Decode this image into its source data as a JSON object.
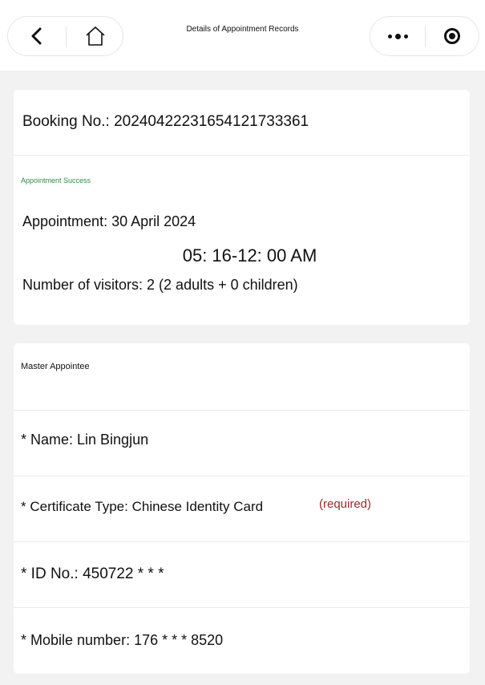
{
  "header": {
    "title": "Details of Appointment Records",
    "back_icon": "chevron-left-icon",
    "home_icon": "home-icon",
    "more_icon": "more-dots-icon",
    "close_icon": "target-circle-icon"
  },
  "booking": {
    "number_text": "Booking No.: 20240422231654121733361"
  },
  "appointment": {
    "status": "Appointment Success",
    "date_text": "Appointment: 30 April 2024",
    "time_text": "05: 16-12: 00 AM",
    "visitors_text": "Number of visitors: 2 (2 adults + 0 children)",
    "status_color": "#2e8b4a"
  },
  "appointee": {
    "section_title": "Master Appointee",
    "name_text": "* Name: Lin Bingjun",
    "certificate_text": "* Certificate Type: Chinese Identity Card",
    "required_label": "(required)",
    "id_text": "* ID No.: 450722 * * *",
    "mobile_text": "* Mobile number: 176 * * * 8520",
    "required_color": "#9a2b2b"
  }
}
